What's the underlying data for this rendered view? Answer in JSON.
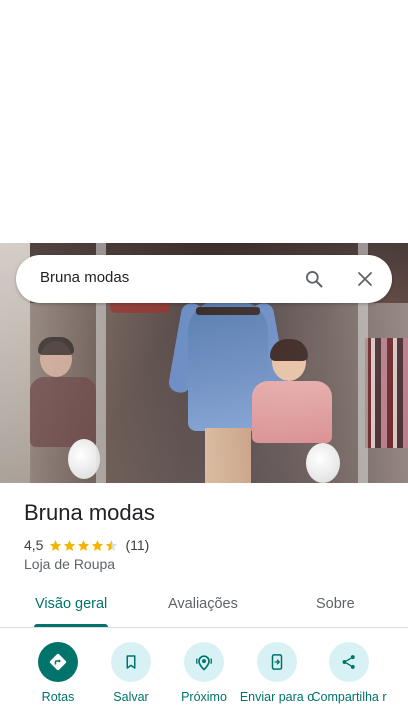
{
  "search": {
    "query": "Bruna modas",
    "search_icon": "search-icon",
    "clear_icon": "close-icon"
  },
  "place": {
    "name": "Bruna modas",
    "rating": "4,5",
    "rating_value": 4.5,
    "review_count": "(11)",
    "category": "Loja de Roupa"
  },
  "tabs": [
    {
      "label": "Visão geral",
      "active": true
    },
    {
      "label": "Avaliações",
      "active": false
    },
    {
      "label": "Sobre",
      "active": false
    }
  ],
  "actions": [
    {
      "label": "Rotas",
      "icon": "directions-icon"
    },
    {
      "label": "Salvar",
      "icon": "bookmark-icon"
    },
    {
      "label": "Próximo",
      "icon": "nearby-icon"
    },
    {
      "label": "Enviar para o",
      "icon": "send-to-phone-icon"
    },
    {
      "label": "Compartilha r",
      "icon": "share-icon"
    }
  ],
  "colors": {
    "accent": "#00736b",
    "accent_light": "#d8f1f4",
    "star": "#f4b400",
    "text_primary": "#202124",
    "text_secondary": "#5f6368"
  }
}
